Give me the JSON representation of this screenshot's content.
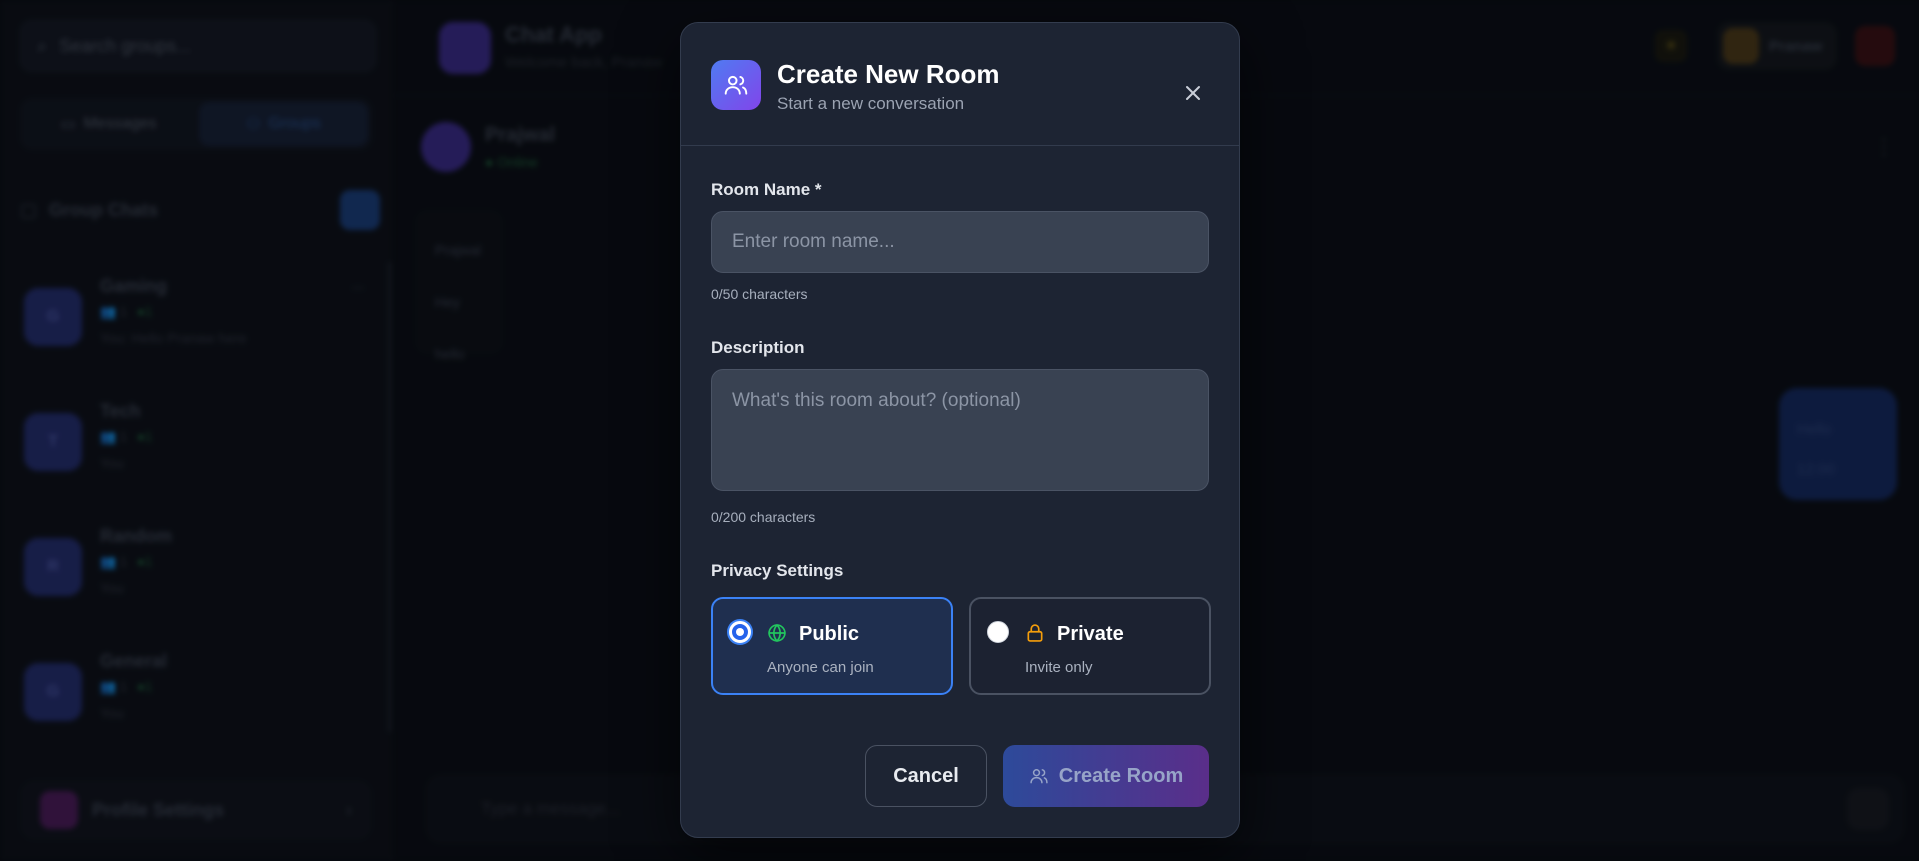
{
  "background": {
    "search_placeholder": "Search groups...",
    "tabs": [
      "Messages",
      "Groups"
    ],
    "group_header": "Group Chats",
    "groups": [
      {
        "initial": "G",
        "name": "Gaming",
        "members": "👥 1",
        "status": "●1",
        "last": "You: Hello Pranaw here",
        "time": "—"
      },
      {
        "initial": "T",
        "name": "Tech",
        "members": "👥 1",
        "status": "●1",
        "last": "You",
        "time": ""
      },
      {
        "initial": "R",
        "name": "Random",
        "members": "👥 1",
        "status": "●1",
        "last": "You",
        "time": ""
      },
      {
        "initial": "G",
        "name": "General",
        "members": "👥 1",
        "status": "●1",
        "last": "You",
        "time": ""
      }
    ],
    "profile_settings": "Profile Settings",
    "app_title": "Chat App",
    "app_subtitle": "Welcome back, Pranaw",
    "username": "Pranaw",
    "chat_name": "Prajwal",
    "chat_status": "● Online",
    "left_messages": [
      "Prajwal",
      "Hey",
      "hello"
    ],
    "right_message": [
      "Hello",
      "12:00"
    ],
    "input_placeholder": "Type a message..."
  },
  "modal": {
    "title": "Create New Room",
    "subtitle": "Start a new conversation",
    "room_name_label": "Room Name *",
    "room_name_placeholder": "Enter room name...",
    "room_name_value": "",
    "room_name_counter": "0/50 characters",
    "description_label": "Description",
    "description_placeholder": "What's this room about? (optional)",
    "description_value": "",
    "description_counter": "0/200 characters",
    "privacy_label": "Privacy Settings",
    "privacy_options": [
      {
        "title": "Public",
        "desc": "Anyone can join",
        "icon": "globe-icon",
        "selected": true
      },
      {
        "title": "Private",
        "desc": "Invite only",
        "icon": "lock-icon",
        "selected": false
      }
    ],
    "cancel_label": "Cancel",
    "create_label": "Create Room"
  },
  "colors": {
    "accent_blue": "#3b82f6",
    "gradient_start": "#4f7bf2",
    "gradient_end": "#8145ea",
    "globe_green": "#22c55e",
    "lock_amber": "#f59e0b"
  }
}
